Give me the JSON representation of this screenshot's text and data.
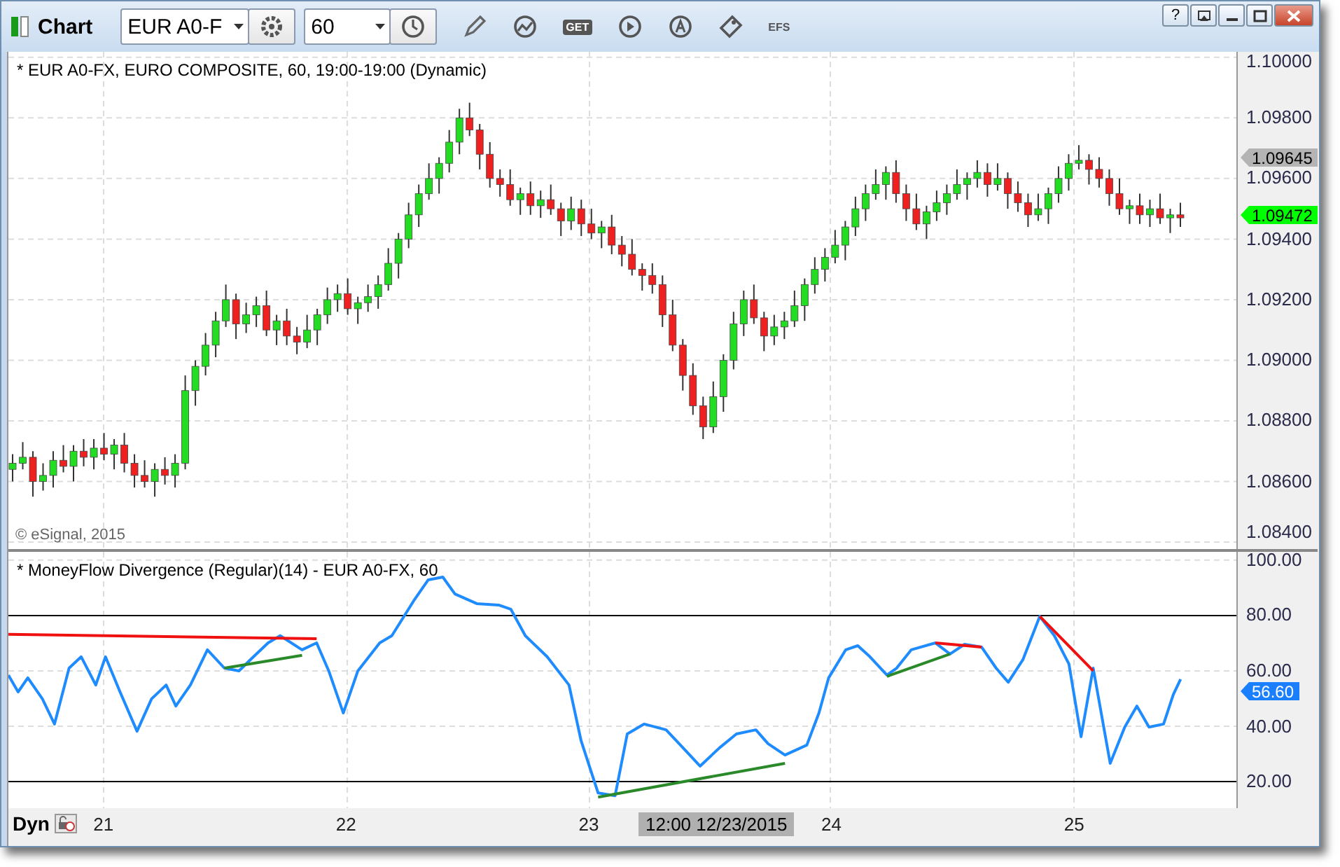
{
  "window": {
    "title": "Chart",
    "controls": [
      "?"
    ]
  },
  "toolbar": {
    "symbol": "EUR A0-F",
    "interval": "60",
    "get_label": "GET",
    "efs_label": "EFS"
  },
  "price_panel": {
    "title": "* EUR A0-FX, EURO COMPOSITE, 60, 19:00-19:00 (Dynamic)",
    "copyright": "© eSignal, 2015",
    "chart_data": {
      "type": "candlestick",
      "categories": [
        null,
        null,
        null,
        null,
        null,
        null,
        null,
        null,
        null,
        null,
        null,
        null,
        null,
        null,
        null,
        null,
        null,
        null,
        null,
        null,
        null,
        null,
        null,
        null,
        null,
        null,
        null,
        null,
        null,
        null,
        null,
        null,
        null,
        null,
        null,
        null,
        null,
        null,
        null,
        null,
        null,
        null,
        null,
        null,
        null,
        null,
        null,
        null,
        null,
        null,
        null,
        null,
        null,
        null,
        null,
        null,
        null,
        null,
        null,
        null,
        null,
        null,
        null,
        null,
        null,
        null,
        null,
        null,
        null,
        null,
        null,
        null,
        null,
        null,
        null,
        null,
        null,
        null,
        null,
        null,
        null,
        null,
        null,
        null,
        null,
        null,
        null,
        null,
        null,
        null,
        null,
        null,
        null,
        null,
        null,
        null,
        null,
        null,
        null,
        null,
        null,
        null,
        null,
        null,
        null,
        null,
        null,
        null,
        null,
        null,
        null,
        null,
        null,
        null,
        null,
        null
      ],
      "grid": true,
      "ylim": [
        1.08377,
        1.10018
      ],
      "yticks": [
        {
          "value": 1.1,
          "label": "1.10000"
        },
        {
          "value": 1.098,
          "label": "1.09800"
        },
        {
          "value": 1.096,
          "label": "1.09600"
        },
        {
          "value": 1.094,
          "label": "1.09400"
        },
        {
          "value": 1.092,
          "label": "1.09200"
        },
        {
          "value": 1.09,
          "label": "1.09000"
        },
        {
          "value": 1.088,
          "label": "1.08800"
        },
        {
          "value": 1.086,
          "label": "1.08600"
        },
        {
          "value": 1.084,
          "label": "1.08400"
        }
      ],
      "ohlc": [
        [
          1.0864,
          1.0869,
          1.086,
          1.0866
        ],
        [
          1.0866,
          1.0873,
          1.0864,
          1.0868
        ],
        [
          1.0868,
          1.087,
          1.0855,
          1.086
        ],
        [
          1.086,
          1.0866,
          1.0857,
          1.0862
        ],
        [
          1.0862,
          1.087,
          1.0858,
          1.0867
        ],
        [
          1.0867,
          1.0872,
          1.0863,
          1.0865
        ],
        [
          1.0865,
          1.0872,
          1.086,
          1.087
        ],
        [
          1.087,
          1.0874,
          1.0865,
          1.0868
        ],
        [
          1.0868,
          1.0874,
          1.0864,
          1.0871
        ],
        [
          1.0871,
          1.0876,
          1.0867,
          1.0869
        ],
        [
          1.0869,
          1.0874,
          1.0864,
          1.0872
        ],
        [
          1.0872,
          1.0876,
          1.0863,
          1.0866
        ],
        [
          1.0866,
          1.0869,
          1.0858,
          1.0862
        ],
        [
          1.0862,
          1.0867,
          1.0858,
          1.086
        ],
        [
          1.086,
          1.0866,
          1.0855,
          1.0864
        ],
        [
          1.0864,
          1.0868,
          1.0859,
          1.0862
        ],
        [
          1.0862,
          1.0869,
          1.0858,
          1.0866
        ],
        [
          1.0866,
          1.0895,
          1.0864,
          1.089
        ],
        [
          1.089,
          1.09,
          1.0885,
          1.0898
        ],
        [
          1.0898,
          1.0909,
          1.0895,
          1.0905
        ],
        [
          1.0905,
          1.0916,
          1.0901,
          1.0913
        ],
        [
          1.0913,
          1.0925,
          1.0911,
          1.092
        ],
        [
          1.092,
          1.0922,
          1.0907,
          1.0912
        ],
        [
          1.0912,
          1.0919,
          1.0909,
          1.0915
        ],
        [
          1.0915,
          1.0921,
          1.0911,
          1.0918
        ],
        [
          1.0918,
          1.0923,
          1.0908,
          1.091
        ],
        [
          1.091,
          1.0915,
          1.0905,
          1.0913
        ],
        [
          1.0913,
          1.0917,
          1.0905,
          1.0908
        ],
        [
          1.0908,
          1.0911,
          1.0902,
          1.0906
        ],
        [
          1.0906,
          1.0915,
          1.0904,
          1.091
        ],
        [
          1.091,
          1.0917,
          1.0905,
          1.0915
        ],
        [
          1.0915,
          1.0924,
          1.0912,
          1.092
        ],
        [
          1.092,
          1.0925,
          1.0916,
          1.0922
        ],
        [
          1.0922,
          1.0927,
          1.0915,
          1.0917
        ],
        [
          1.0917,
          1.0921,
          1.0912,
          1.0919
        ],
        [
          1.0919,
          1.0925,
          1.0916,
          1.0921
        ],
        [
          1.0921,
          1.0928,
          1.0917,
          1.0925
        ],
        [
          1.0925,
          1.0937,
          1.0923,
          1.0932
        ],
        [
          1.0932,
          1.0942,
          1.0927,
          1.094
        ],
        [
          1.094,
          1.0952,
          1.0937,
          1.0948
        ],
        [
          1.0948,
          1.0958,
          1.0944,
          1.0955
        ],
        [
          1.0955,
          1.0965,
          1.0953,
          1.096
        ],
        [
          1.096,
          1.0967,
          1.0955,
          1.0965
        ],
        [
          1.0965,
          1.0976,
          1.0962,
          1.0972
        ],
        [
          1.0972,
          1.0983,
          1.0968,
          1.098
        ],
        [
          1.098,
          1.0985,
          1.0974,
          1.0976
        ],
        [
          1.0976,
          1.0978,
          1.0963,
          1.0968
        ],
        [
          1.0968,
          1.0972,
          1.0957,
          1.096
        ],
        [
          1.096,
          1.0963,
          1.0954,
          1.0958
        ],
        [
          1.0958,
          1.0963,
          1.0951,
          1.0953
        ],
        [
          1.0953,
          1.0957,
          1.0948,
          1.0955
        ],
        [
          1.0955,
          1.0959,
          1.0948,
          1.0951
        ],
        [
          1.0951,
          1.0956,
          1.0947,
          1.0953
        ],
        [
          1.0953,
          1.0958,
          1.0948,
          1.095
        ],
        [
          1.095,
          1.0952,
          1.0941,
          1.0946
        ],
        [
          1.0946,
          1.0954,
          1.0943,
          1.095
        ],
        [
          1.095,
          1.0953,
          1.0941,
          1.0945
        ],
        [
          1.0945,
          1.095,
          1.094,
          1.0942
        ],
        [
          1.0942,
          1.0946,
          1.0937,
          1.0944
        ],
        [
          1.0944,
          1.0948,
          1.0935,
          1.0938
        ],
        [
          1.0938,
          1.0941,
          1.0931,
          1.0935
        ],
        [
          1.0935,
          1.094,
          1.0928,
          1.093
        ],
        [
          1.093,
          1.0932,
          1.0923,
          1.0928
        ],
        [
          1.0928,
          1.0932,
          1.0922,
          1.0925
        ],
        [
          1.0925,
          1.0928,
          1.0911,
          1.0915
        ],
        [
          1.0915,
          1.092,
          1.0903,
          1.0905
        ],
        [
          1.0905,
          1.0907,
          1.089,
          1.0895
        ],
        [
          1.0895,
          1.0899,
          1.0882,
          1.0885
        ],
        [
          1.0885,
          1.0888,
          1.0874,
          1.0878
        ],
        [
          1.0878,
          1.0893,
          1.0876,
          1.0888
        ],
        [
          1.0888,
          1.0902,
          1.0883,
          1.09
        ],
        [
          1.09,
          1.0916,
          1.0897,
          1.0912
        ],
        [
          1.0912,
          1.0923,
          1.0908,
          1.092
        ],
        [
          1.092,
          1.0925,
          1.0912,
          1.0914
        ],
        [
          1.0914,
          1.0916,
          1.0903,
          1.0908
        ],
        [
          1.0908,
          1.0915,
          1.0905,
          1.0911
        ],
        [
          1.0911,
          1.0916,
          1.0907,
          1.0913
        ],
        [
          1.0913,
          1.0923,
          1.0911,
          1.0918
        ],
        [
          1.0918,
          1.0927,
          1.0913,
          1.0925
        ],
        [
          1.0925,
          1.0934,
          1.0922,
          1.093
        ],
        [
          1.093,
          1.0937,
          1.0926,
          1.0934
        ],
        [
          1.0934,
          1.0943,
          1.0932,
          1.0938
        ],
        [
          1.0938,
          1.0946,
          1.0933,
          1.0944
        ],
        [
          1.0944,
          1.0954,
          1.0941,
          1.095
        ],
        [
          1.095,
          1.0958,
          1.0946,
          1.0955
        ],
        [
          1.0955,
          1.0963,
          1.0953,
          1.0958
        ],
        [
          1.0958,
          1.0964,
          1.0953,
          1.0962
        ],
        [
          1.0962,
          1.0966,
          1.0952,
          1.0955
        ],
        [
          1.0955,
          1.0958,
          1.0946,
          1.095
        ],
        [
          1.095,
          1.0955,
          1.0943,
          1.0945
        ],
        [
          1.0945,
          1.0951,
          1.094,
          1.0949
        ],
        [
          1.0949,
          1.0956,
          1.0946,
          1.0952
        ],
        [
          1.0952,
          1.0958,
          1.0948,
          1.0955
        ],
        [
          1.0955,
          1.0963,
          1.0953,
          1.0958
        ],
        [
          1.0958,
          1.0962,
          1.0953,
          1.096
        ],
        [
          1.096,
          1.0966,
          1.0957,
          1.0962
        ],
        [
          1.0962,
          1.0965,
          1.0954,
          1.0958
        ],
        [
          1.0958,
          1.0965,
          1.0956,
          1.096
        ],
        [
          1.096,
          1.0962,
          1.095,
          1.0955
        ],
        [
          1.0955,
          1.0959,
          1.0949,
          1.0952
        ],
        [
          1.0952,
          1.0955,
          1.0944,
          1.0948
        ],
        [
          1.0948,
          1.0955,
          1.0946,
          1.095
        ],
        [
          1.095,
          1.0957,
          1.0945,
          1.0955
        ],
        [
          1.0955,
          1.0964,
          1.0952,
          1.096
        ],
        [
          1.096,
          1.0968,
          1.0956,
          1.0965
        ],
        [
          1.0965,
          1.0971,
          1.0963,
          1.0966
        ],
        [
          1.0966,
          1.0968,
          1.0958,
          1.0963
        ],
        [
          1.0963,
          1.0967,
          1.0957,
          1.096
        ],
        [
          1.096,
          1.0963,
          1.0951,
          1.0955
        ],
        [
          1.0955,
          1.096,
          1.0948,
          1.095
        ],
        [
          1.095,
          1.0953,
          1.0945,
          1.0951
        ],
        [
          1.0951,
          1.0955,
          1.0945,
          1.0948
        ],
        [
          1.0948,
          1.0953,
          1.0944,
          1.095
        ],
        [
          1.095,
          1.0955,
          1.0945,
          1.0947
        ],
        [
          1.0947,
          1.095,
          1.0942,
          1.0948
        ],
        [
          1.0948,
          1.0952,
          1.0944,
          1.0947
        ]
      ]
    },
    "price_tags": [
      {
        "label": "1.09645",
        "color": "#b4b4b4"
      },
      {
        "label": "1.09472",
        "color": "#00ff00"
      }
    ]
  },
  "indicator_panel": {
    "title": "* MoneyFlow Divergence (Regular)(14) - EUR A0-FX, 60",
    "value_tag": "56.60",
    "chart_data": {
      "type": "line",
      "grid": true,
      "xlim": [
        20.61,
        25.67
      ],
      "ylim": [
        10.4,
        103
      ],
      "xticks": [
        {
          "value": 21,
          "label": "21"
        },
        {
          "value": 22,
          "label": "22"
        },
        {
          "value": 23,
          "label": "23"
        },
        {
          "value": 24,
          "label": "24"
        },
        {
          "value": 25,
          "label": "25"
        }
      ],
      "yticks": [
        {
          "value": 100,
          "label": "100.00"
        },
        {
          "value": 80,
          "label": "80.00"
        },
        {
          "value": 60,
          "label": "60.00"
        },
        {
          "value": 40,
          "label": "40.00"
        },
        {
          "value": 20,
          "label": "20.00"
        }
      ],
      "x": [
        20.61,
        20.65,
        20.69,
        20.75,
        20.8,
        20.86,
        20.91,
        20.97,
        21.01,
        21.07,
        21.14,
        21.2,
        21.26,
        21.3,
        21.36,
        21.43,
        21.5,
        21.56,
        21.62,
        21.68,
        21.73,
        21.82,
        21.88,
        21.93,
        21.99,
        22.05,
        22.14,
        22.19,
        22.28,
        22.34,
        22.4,
        22.45,
        22.54,
        22.63,
        22.68,
        22.74,
        22.83,
        22.92,
        22.97,
        23.04,
        23.11,
        23.16,
        23.23,
        23.32,
        23.39,
        23.46,
        23.54,
        23.61,
        23.69,
        23.74,
        23.81,
        23.9,
        23.95,
        23.99,
        24.06,
        24.11,
        24.16,
        24.23,
        24.27,
        24.33,
        24.43,
        24.49,
        24.55,
        24.62,
        24.68,
        24.73,
        24.79,
        24.86,
        24.92,
        24.98,
        25.03,
        25.08,
        25.15,
        25.21,
        25.26,
        25.31,
        25.37,
        25.41,
        25.44
      ],
      "series": [
        {
          "color": "#1e8cff",
          "values": [
            58.5,
            52.4,
            57.5,
            49.9,
            40.8,
            61.0,
            65.1,
            54.9,
            65.1,
            52.4,
            38.2,
            49.9,
            54.9,
            47.3,
            54.9,
            67.6,
            61.0,
            60.0,
            65.1,
            70.1,
            72.7,
            67.6,
            70.1,
            60.0,
            44.8,
            60.0,
            70.1,
            72.7,
            85.3,
            92.9,
            93.9,
            87.8,
            84.3,
            83.8,
            82.3,
            72.7,
            65.1,
            54.9,
            34.7,
            15.9,
            14.9,
            37.2,
            40.8,
            38.7,
            32.2,
            25.6,
            32.2,
            37.2,
            38.7,
            33.7,
            29.6,
            33.2,
            44.8,
            57.5,
            67.6,
            69.1,
            65.1,
            58.5,
            61.0,
            67.6,
            70.1,
            66.1,
            69.6,
            68.6,
            61.0,
            55.9,
            64.0,
            79.7,
            72.7,
            62.5,
            36.2,
            61.0,
            26.6,
            39.7,
            47.3,
            39.7,
            40.8,
            51.4,
            57.0
          ]
        },
        {
          "color": "#f01010",
          "values": [
            73.2,
            null,
            null,
            null,
            null,
            null,
            null,
            null,
            null,
            null,
            null,
            null,
            null,
            null,
            null,
            null,
            null,
            null,
            null,
            null,
            null,
            null,
            71.6,
            null,
            null,
            null,
            null,
            null,
            null,
            null,
            null,
            null,
            null,
            null,
            null,
            null,
            null,
            null,
            null,
            null,
            null,
            null,
            null,
            null,
            null,
            null,
            null,
            null,
            null,
            null,
            null,
            null,
            null,
            null,
            null,
            null,
            null,
            null,
            null,
            null,
            null,
            null,
            null,
            null,
            null,
            null,
            null,
            null,
            null,
            null,
            null,
            null,
            null,
            null,
            null,
            null,
            null,
            null,
            null
          ]
        },
        {
          "color": "#2a8a2a",
          "values": [
            null,
            null,
            null,
            null,
            null,
            null,
            null,
            null,
            null,
            null,
            null,
            null,
            null,
            null,
            null,
            null,
            61.0,
            null,
            null,
            null,
            null,
            65.6,
            null,
            null,
            null,
            null,
            null,
            null,
            null,
            null,
            null,
            null,
            null,
            null,
            null,
            null,
            null,
            null,
            null,
            null,
            null,
            null,
            null,
            null,
            null,
            null,
            null,
            null,
            null,
            null,
            null,
            null,
            null,
            null,
            null,
            null,
            null,
            null,
            null,
            null,
            null,
            null,
            null,
            null,
            null,
            null,
            null,
            null,
            null,
            null,
            null,
            null,
            null,
            null,
            null,
            null,
            null,
            null,
            null
          ]
        },
        {
          "color": "#2a8a2a",
          "values": [
            null,
            null,
            null,
            null,
            null,
            null,
            null,
            null,
            null,
            null,
            null,
            null,
            null,
            null,
            null,
            null,
            null,
            null,
            null,
            null,
            null,
            null,
            null,
            null,
            null,
            null,
            null,
            null,
            null,
            null,
            null,
            null,
            null,
            null,
            null,
            null,
            null,
            null,
            null,
            14.4,
            null,
            null,
            null,
            null,
            null,
            null,
            null,
            null,
            null,
            null,
            26.6,
            null,
            null,
            null,
            null,
            null,
            null,
            null,
            null,
            null,
            null,
            null,
            null,
            null,
            null,
            null,
            null,
            null,
            null,
            null,
            null,
            null,
            null,
            null,
            null,
            null,
            null,
            null,
            null
          ]
        },
        {
          "color": "#2a8a2a",
          "values": [
            null,
            null,
            null,
            null,
            null,
            null,
            null,
            null,
            null,
            null,
            null,
            null,
            null,
            null,
            null,
            null,
            null,
            null,
            null,
            null,
            null,
            null,
            null,
            null,
            null,
            null,
            null,
            null,
            null,
            null,
            null,
            null,
            null,
            null,
            null,
            null,
            null,
            null,
            null,
            null,
            null,
            null,
            null,
            null,
            null,
            null,
            null,
            null,
            null,
            null,
            null,
            null,
            null,
            null,
            null,
            null,
            null,
            58.0,
            null,
            null,
            null,
            66.1,
            null,
            null,
            null,
            null,
            null,
            null,
            null,
            null,
            null,
            null,
            null,
            null,
            null,
            null,
            null,
            null,
            null
          ]
        },
        {
          "color": "#f01010",
          "values": [
            null,
            null,
            null,
            null,
            null,
            null,
            null,
            null,
            null,
            null,
            null,
            null,
            null,
            null,
            null,
            null,
            null,
            null,
            null,
            null,
            null,
            null,
            null,
            null,
            null,
            null,
            null,
            null,
            null,
            null,
            null,
            null,
            null,
            null,
            null,
            null,
            null,
            null,
            null,
            null,
            null,
            null,
            null,
            null,
            null,
            null,
            null,
            null,
            null,
            null,
            null,
            null,
            null,
            null,
            null,
            null,
            null,
            null,
            null,
            null,
            70.1,
            null,
            null,
            68.6,
            null,
            null,
            null,
            null,
            null,
            null,
            null,
            null,
            null,
            null,
            null,
            null,
            null,
            null,
            null
          ]
        },
        {
          "color": "#f01010",
          "values": [
            null,
            null,
            null,
            null,
            null,
            null,
            null,
            null,
            null,
            null,
            null,
            null,
            null,
            null,
            null,
            null,
            null,
            null,
            null,
            null,
            null,
            null,
            null,
            null,
            null,
            null,
            null,
            null,
            null,
            null,
            null,
            null,
            null,
            null,
            null,
            null,
            null,
            null,
            null,
            null,
            null,
            null,
            null,
            null,
            null,
            null,
            null,
            null,
            null,
            null,
            null,
            null,
            null,
            null,
            null,
            null,
            null,
            null,
            null,
            null,
            null,
            null,
            null,
            null,
            null,
            null,
            null,
            79.7,
            null,
            null,
            null,
            60.0,
            null,
            null,
            null,
            null,
            null,
            null,
            null
          ]
        }
      ]
    }
  },
  "time_axis": {
    "mode": "Dyn",
    "cursor": "12:00 12/23/2015"
  }
}
